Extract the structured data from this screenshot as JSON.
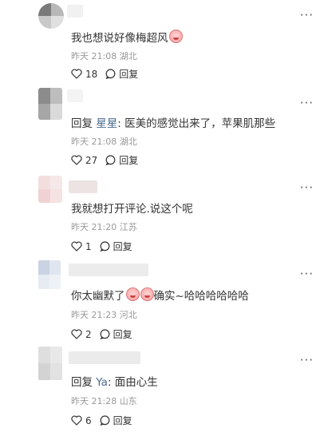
{
  "comments": [
    {
      "text": "我也想说好像梅超风",
      "emoji_after": true,
      "time": "昨天 21:08",
      "location": "湖北",
      "likes": "18",
      "reply_label": "回复"
    },
    {
      "reply_prefix": "回复 ",
      "reply_to": "星星",
      "text": ": 医美的感觉出来了，苹果肌那些",
      "time": "昨天 21:08",
      "location": "湖北",
      "likes": "27",
      "reply_label": "回复"
    },
    {
      "text": "我就想打开评论.说这个呢",
      "time": "昨天 21:20",
      "location": "江苏",
      "likes": "1",
      "reply_label": "回复"
    },
    {
      "text_before": "你太幽默了",
      "text_after": "确实~哈哈哈哈哈哈",
      "time": "昨天 21:23",
      "location": "河北",
      "likes": "2",
      "reply_label": "回复"
    },
    {
      "reply_prefix": "回复 ",
      "reply_to": "Ya",
      "text": ": 面由心生",
      "time": "昨天 21:28",
      "location": "山东",
      "likes": "6",
      "reply_label": "回复"
    }
  ],
  "icons": {
    "more": "more-icon",
    "like": "heart-icon",
    "reply": "comment-bubble-icon",
    "emoji": "laughing-crying-emoji-icon"
  },
  "colors": {
    "text": "#333333",
    "meta": "#999999",
    "reply_name": "#4b6b8f"
  }
}
